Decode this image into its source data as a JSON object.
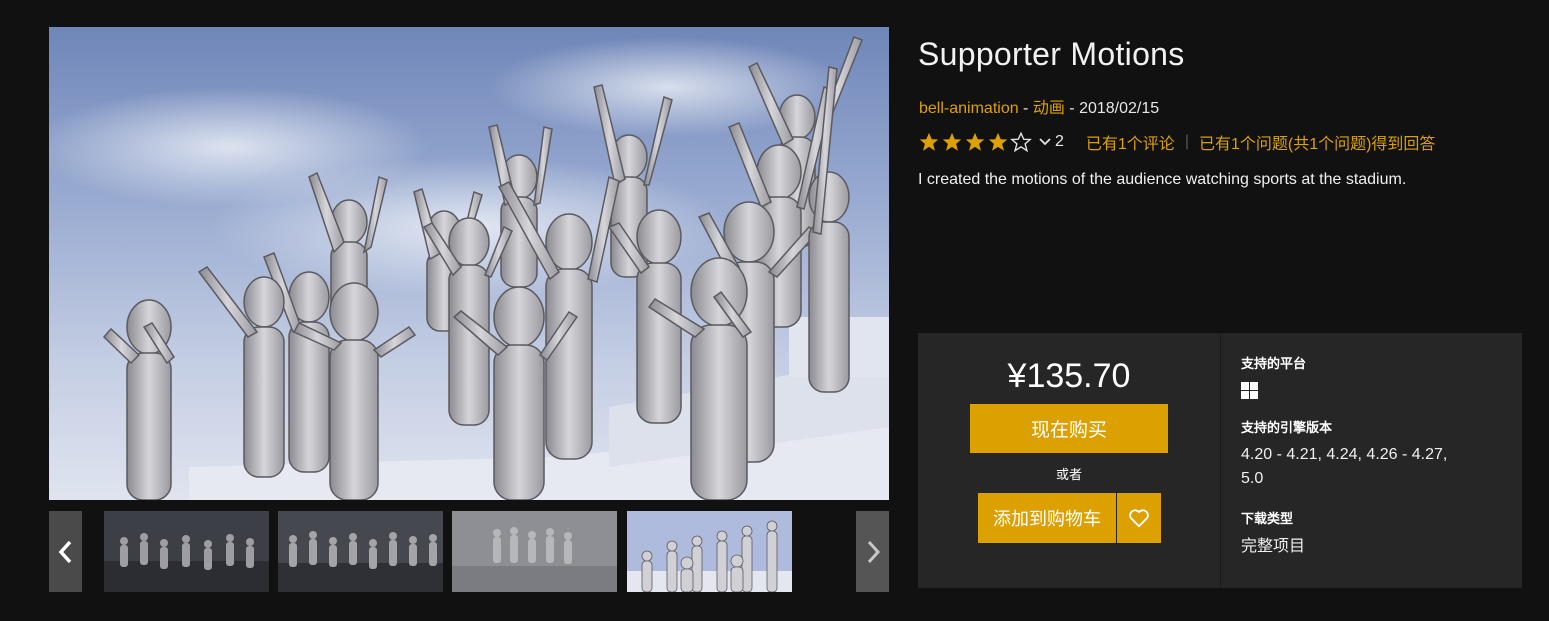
{
  "product": {
    "title": "Supporter Motions",
    "seller": "bell-animation",
    "separator1": " - ",
    "category": "动画",
    "separator2": " - ",
    "date": "2018/02/15",
    "rating_stars": 4,
    "rating_count": "2",
    "reviews_link": "已有1个评论",
    "questions_link": "已有1个问题(共1个问题)得到回答",
    "description": "I created the motions of the audience watching sports at the stadium."
  },
  "purchase": {
    "price": "¥135.70",
    "buy_now_label": "现在购买",
    "or_label": "或者",
    "add_to_cart_label": "添加到购物车"
  },
  "specs": {
    "platform_label": "支持的平台",
    "platform_icon": "windows-icon",
    "engine_label": "支持的引擎版本",
    "engine_versions_line1": "4.20 - 4.21, 4.24, 4.26 - 4.27,",
    "engine_versions_line2": "5.0",
    "download_label": "下载类型",
    "download_type": "完整项目"
  },
  "gallery": {
    "thumbnail_count": 4,
    "selected_thumbnail": 4
  },
  "colors": {
    "accent": "#dca100",
    "background": "#111111",
    "panel": "#262626"
  }
}
